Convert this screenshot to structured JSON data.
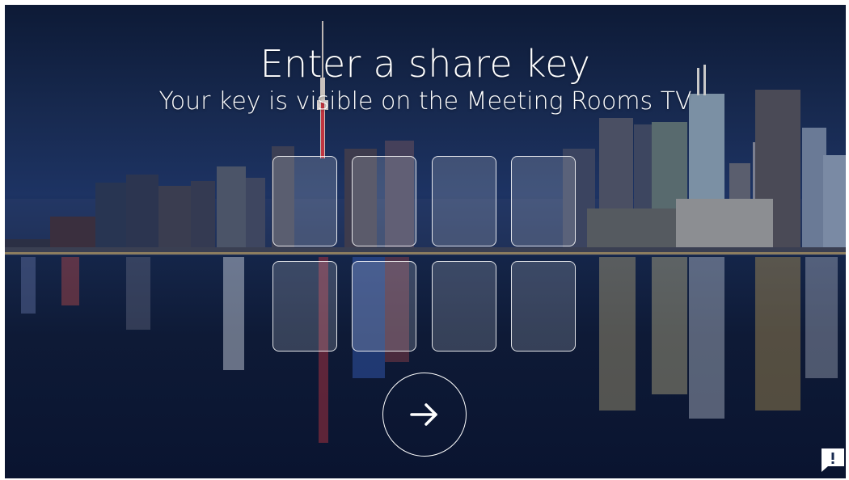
{
  "header": {
    "title": "Enter a share key",
    "subtitle": "Your key is visible on the Meeting Rooms TV"
  },
  "key_entry": {
    "slot_count": 8,
    "slots": [
      "",
      "",
      "",
      "",
      "",
      "",
      "",
      ""
    ]
  },
  "submit": {
    "icon": "arrow-right-icon"
  },
  "feedback": {
    "icon": "feedback-icon"
  },
  "colors": {
    "text": "#ffffff",
    "slot_border": "#ffffff",
    "background_sky": "#17294f",
    "background_water": "#0a1430"
  }
}
